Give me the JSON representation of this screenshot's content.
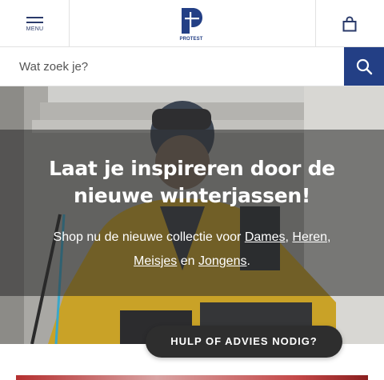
{
  "header": {
    "menu_label": "MENU",
    "logo_text": "PROTEST",
    "brand_color": "#233f85"
  },
  "search": {
    "placeholder": "Wat zoek je?"
  },
  "hero": {
    "title_line1": "Laat je inspireren door de",
    "title_line2": "nieuwe winterjassen!",
    "sub_prefix": "Shop nu de nieuwe collectie voor",
    "link_dames": "Dames",
    "comma1": ",",
    "link_heren": "Heren",
    "comma2": ",",
    "link_meisjes": "Meisjes",
    "sub_and": "en",
    "link_jongens": "Jongens",
    "sub_end": "."
  },
  "help": {
    "label": "HULP OF ADVIES NODIG?"
  }
}
